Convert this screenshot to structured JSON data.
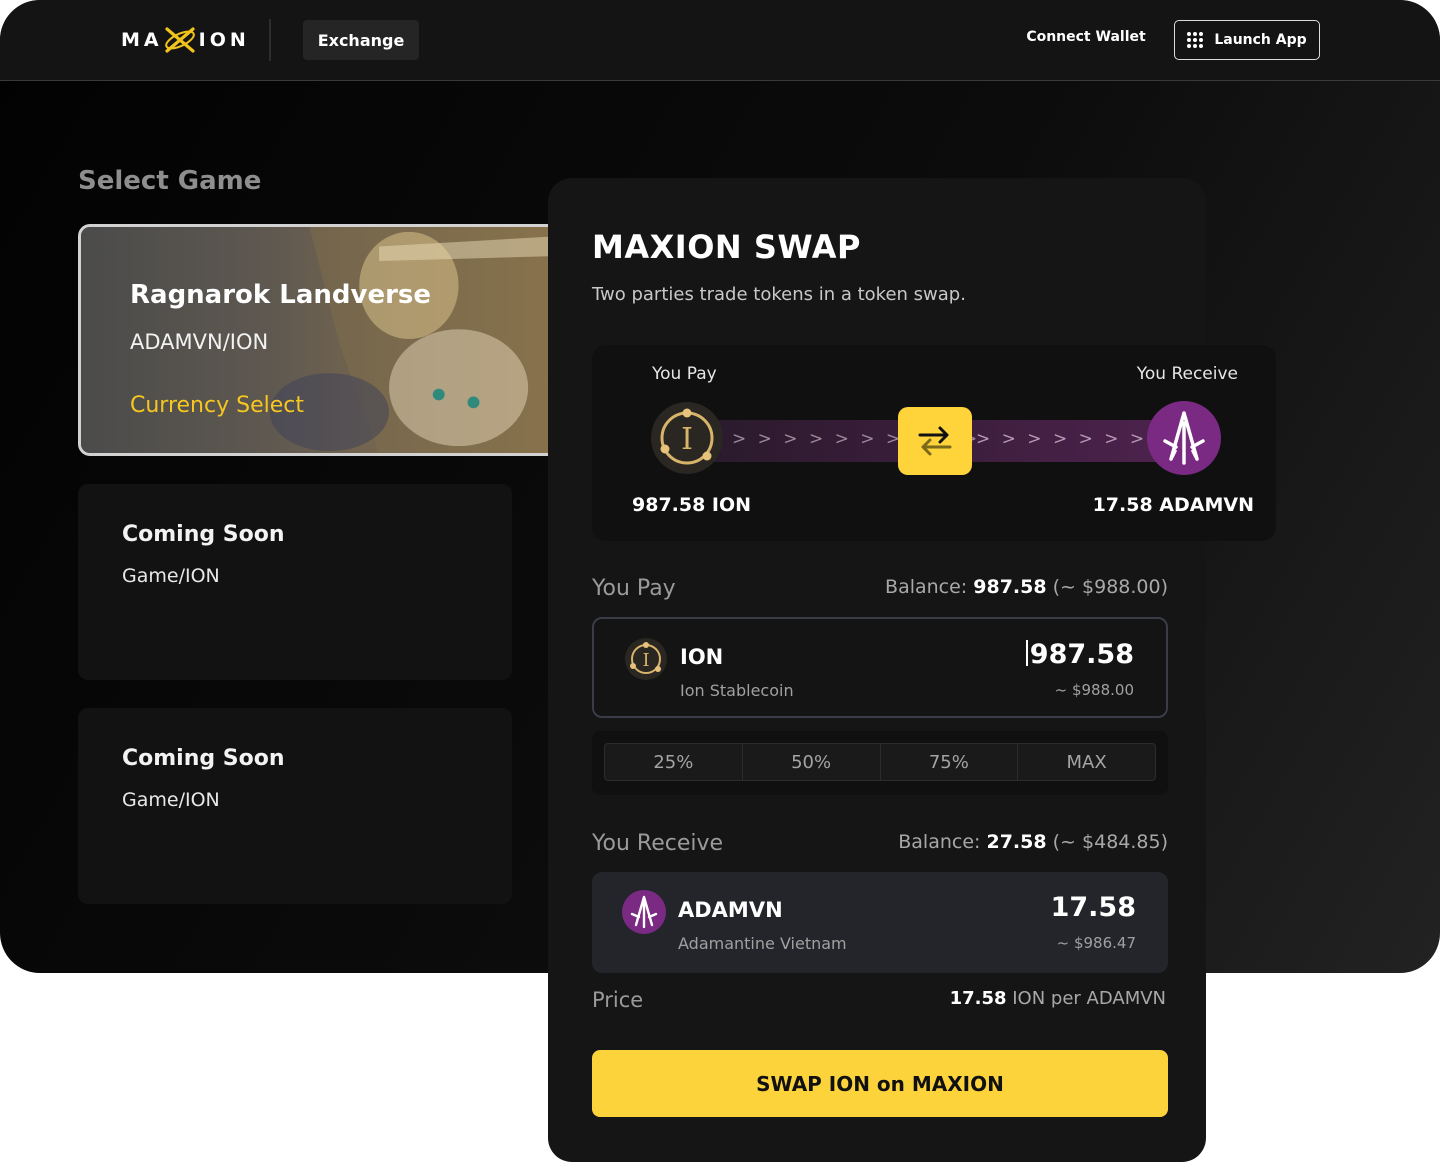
{
  "header": {
    "logo_text": "MAXION",
    "logo_left": "MA",
    "logo_right": "ION",
    "exchange_label": "Exchange",
    "connect_wallet": "Connect Wallet",
    "launch_app": "Launch App"
  },
  "select_game": {
    "title": "Select Game",
    "featured": {
      "name": "Ragnarok Landverse",
      "pair": "ADAMVN/ION",
      "action": "Currency Select"
    },
    "coming_soon": [
      {
        "title": "Coming Soon",
        "pair": "Game/ION"
      },
      {
        "title": "Coming Soon",
        "pair": "Game/ION"
      }
    ]
  },
  "swap": {
    "title": "MAXION SWAP",
    "description": "Two parties trade tokens in a token swap.",
    "flow": {
      "pay_label": "You Pay",
      "receive_label": "You Receive",
      "pay_amount": "987.58 ION",
      "receive_amount": "17.58 ADAMVN",
      "arrows": "> > > > > > > > > >"
    },
    "pay": {
      "label": "You Pay",
      "balance_prefix": "Balance:",
      "balance_value": "987.58",
      "balance_usd": "(~ $988.00)",
      "token_symbol": "ION",
      "token_name": "Ion Stablecoin",
      "amount": "987.58",
      "amount_usd": "~ $988.00"
    },
    "percent_options": [
      "25%",
      "50%",
      "75%",
      "MAX"
    ],
    "receive": {
      "label": "You Receive",
      "balance_prefix": "Balance:",
      "balance_value": "27.58",
      "balance_usd": "(~ $484.85)",
      "token_symbol": "ADAMVN",
      "token_name": "Adamantine Vietnam",
      "amount": "17.58",
      "amount_usd": "~ $986.47"
    },
    "price": {
      "label": "Price",
      "value": "17.58",
      "unit": "ION per ADAMVN"
    },
    "button": "SWAP ION on MAXION"
  },
  "colors": {
    "accent_yellow": "#fdd33b",
    "adamvn_purple": "#7a2a82",
    "ion_gold": "#d8b46a",
    "currency_select": "#f6c71f"
  },
  "icons": {
    "ion": "ion-token-icon",
    "adamvn": "adamvn-token-icon",
    "swap": "swap-arrows-icon",
    "launch": "grid-dots-icon"
  }
}
